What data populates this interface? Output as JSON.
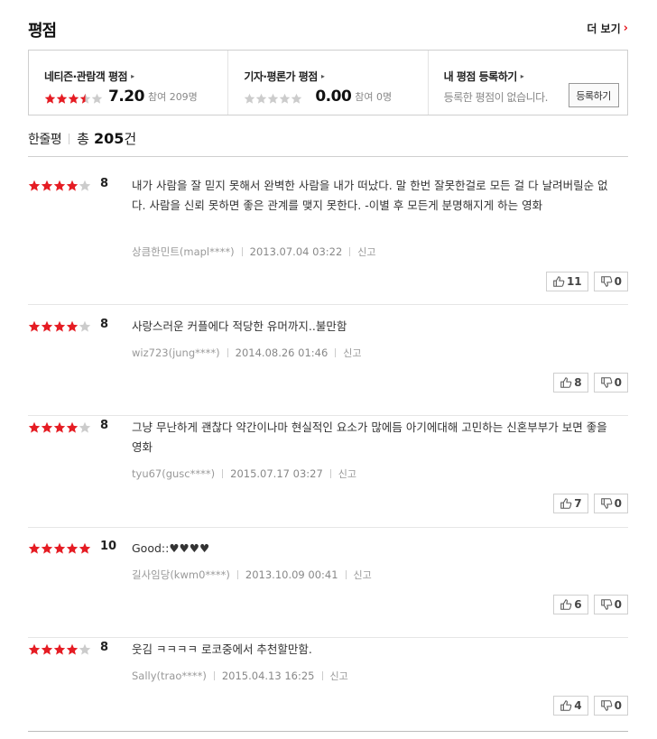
{
  "header": {
    "title": "평점",
    "more_label": "더 보기"
  },
  "colors": {
    "accent": "#e51c23",
    "star_on": "#e51c23",
    "star_off": "#cccccc"
  },
  "scores": {
    "netizen": {
      "label": "네티즌·관람객 평점",
      "score": "7.20",
      "count": "참여 209명",
      "stars": 3.5
    },
    "critic": {
      "label": "기자·평론가 평점",
      "score": "0.00",
      "count": "참여 0명",
      "stars": 0
    },
    "mine": {
      "label": "내 평점 등록하기",
      "empty_text": "등록한 평점이 없습니다.",
      "button_label": "등록하기"
    }
  },
  "tabs": {
    "label": "한줄평",
    "total_word": "총",
    "total_count": "205",
    "total_unit": "건"
  },
  "reviews": [
    {
      "score": "8",
      "stars": 4,
      "text": "내가 사람을 잘 믿지 못해서 완벽한 사람을 내가 떠났다. 말 한번 잘못한걸로 모든 걸 다 날려버릴순 없다. 사람을 신뢰 못하면 좋은 관계를 맺지 못한다. -이별 후 모든게 분명해지게 하는 영화",
      "author": "상큼한민트(mapl****)",
      "date": "2013.07.04 03:22",
      "report": "신고",
      "likes": "11",
      "dislikes": "0"
    },
    {
      "score": "8",
      "stars": 4,
      "text": "사랑스러운 커플에다 적당한 유머까지..불만함",
      "author": "wiz723(jung****)",
      "date": "2014.08.26 01:46",
      "report": "신고",
      "likes": "8",
      "dislikes": "0"
    },
    {
      "score": "8",
      "stars": 4,
      "text": "그냥 무난하게 괜찮다 약간이나마 현실적인 요소가 많에듬 아기에대해 고민하는 신혼부부가 보면 좋을 영화",
      "author": "tyu67(gusc****)",
      "date": "2015.07.17 03:27",
      "report": "신고",
      "likes": "7",
      "dislikes": "0"
    },
    {
      "score": "10",
      "stars": 5,
      "text": "Good::♥♥♥♥",
      "author": "길사임당(kwm0****)",
      "date": "2013.10.09 00:41",
      "report": "신고",
      "likes": "6",
      "dislikes": "0"
    },
    {
      "score": "8",
      "stars": 4,
      "text": "웃김 ㅋㅋㅋㅋ 로코중에서 추천할만함.",
      "author": "Sally(trao****)",
      "date": "2015.04.13 16:25",
      "report": "신고",
      "likes": "4",
      "dislikes": "0"
    }
  ]
}
